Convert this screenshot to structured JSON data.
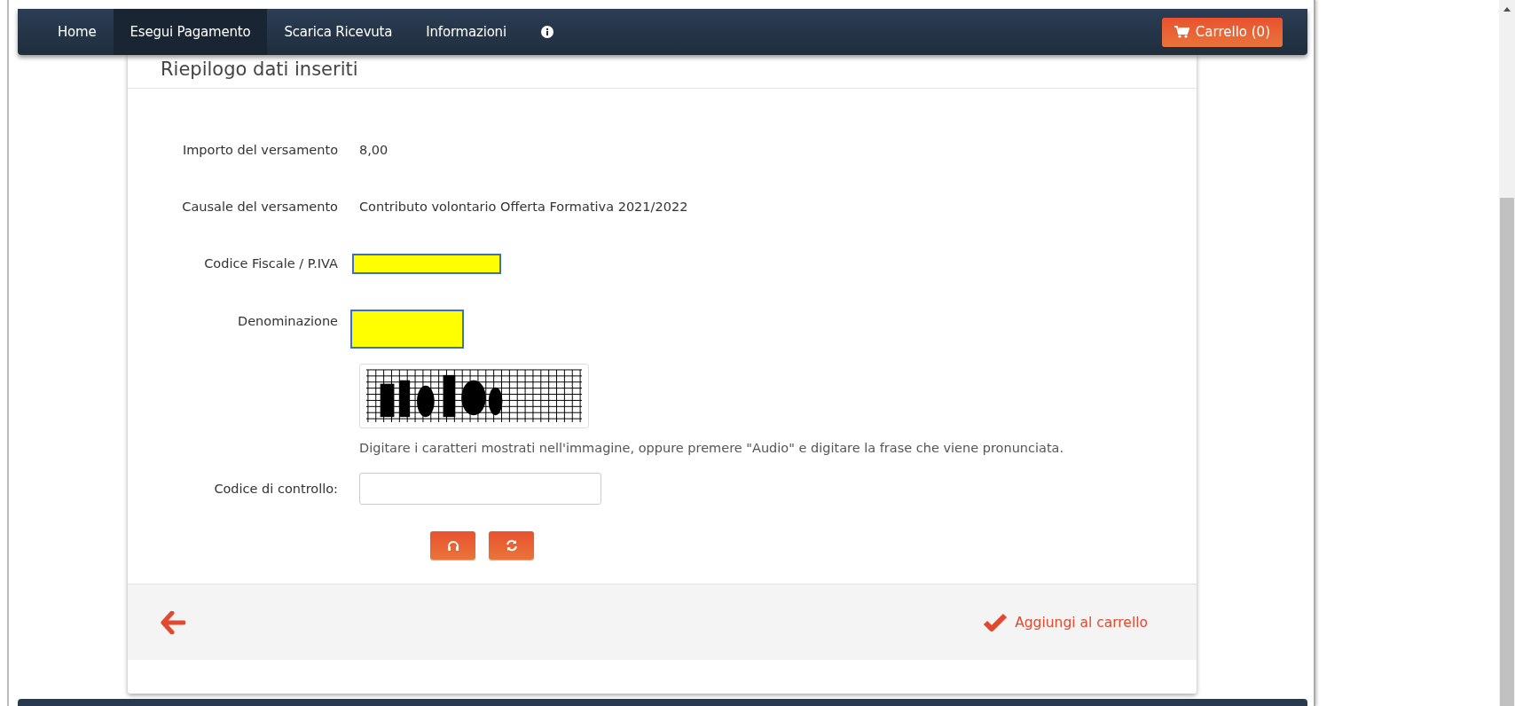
{
  "nav": {
    "items": [
      {
        "label": "Home",
        "selected": false
      },
      {
        "label": "Esegui Pagamento",
        "selected": true
      },
      {
        "label": "Scarica Ricevuta",
        "selected": false
      },
      {
        "label": "Informazioni",
        "selected": false
      }
    ],
    "cart": "Carrello (0)"
  },
  "summary": {
    "title": "Riepilogo dati inseriti",
    "fields": [
      {
        "label": "Importo del versamento",
        "kind": "text",
        "value": "8,00"
      },
      {
        "label": "Causale del versamento",
        "kind": "text",
        "value": "Contributo volontario Offerta Formativa 2021/2022"
      },
      {
        "label": "Codice Fiscale / P.IVA",
        "kind": "redacted"
      },
      {
        "label": "Denominazione",
        "kind": "redacted"
      }
    ]
  },
  "captcha": {
    "hint": "Digitare i caratteri mostrati nell'immagine, oppure premere \"Audio\" e digitare la frase che viene pronunciata.",
    "label": "Codice di controllo:"
  },
  "footer": {
    "action": "Aggiungi al carrello"
  }
}
